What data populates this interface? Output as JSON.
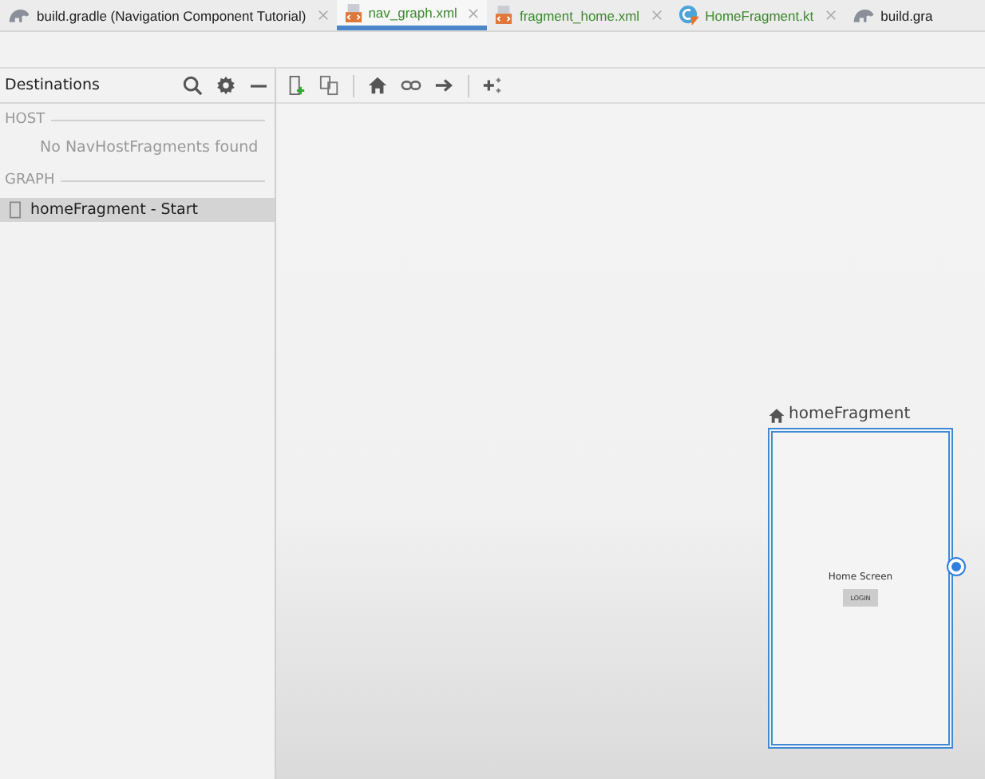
{
  "tabs": [
    {
      "label": "build.gradle (Navigation Component Tutorial)",
      "kind": "gradle",
      "added": false,
      "selected": false
    },
    {
      "label": "nav_graph.xml",
      "kind": "xml",
      "added": true,
      "selected": true
    },
    {
      "label": "fragment_home.xml",
      "kind": "xml",
      "added": true,
      "selected": false
    },
    {
      "label": "HomeFragment.kt",
      "kind": "kotlin",
      "added": true,
      "selected": false
    },
    {
      "label": "build.gra",
      "kind": "gradle",
      "added": false,
      "selected": false
    }
  ],
  "destinations": {
    "title": "Destinations",
    "sections": [
      {
        "heading": "HOST",
        "empty_text": "No NavHostFragments found"
      },
      {
        "heading": "GRAPH",
        "items": [
          {
            "label": "homeFragment - Start",
            "selected": true
          }
        ]
      }
    ]
  },
  "canvas": {
    "nodes": [
      {
        "label": "homeFragment",
        "start": true,
        "selected": true,
        "screen_text": "Home Screen",
        "button_text": "LOGIN"
      }
    ]
  }
}
